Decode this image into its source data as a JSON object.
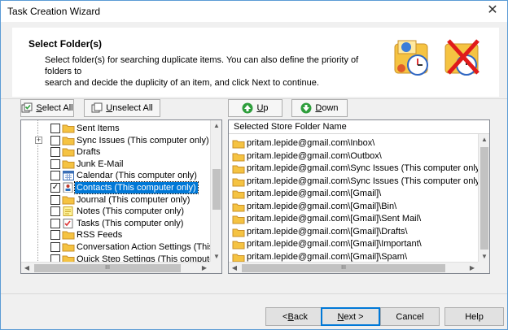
{
  "window": {
    "title": "Task Creation Wizard"
  },
  "header": {
    "title": "Select Folder(s)",
    "description_line1": "Select folder(s) for searching duplicate items. You can also define the priority of folders to",
    "description_line2": "search and decide the duplicity of an item, and click Next to continue."
  },
  "tree_toolbar": {
    "select_all": {
      "mnemonic": "S",
      "rest": "elect All"
    },
    "unselect_all": {
      "mnemonic": "U",
      "rest": "nselect All"
    }
  },
  "list_toolbar": {
    "up": {
      "mnemonic": "U",
      "rest": "p"
    },
    "down": {
      "mnemonic": "D",
      "rest": "own"
    }
  },
  "tree": {
    "items": [
      {
        "label": "Sent Items",
        "checked": false,
        "icon": "folder-icon"
      },
      {
        "label": "Sync Issues (This computer only)",
        "checked": false,
        "icon": "folder-icon",
        "expandable": true
      },
      {
        "label": "Drafts",
        "checked": false,
        "icon": "folder-icon"
      },
      {
        "label": "Junk E-Mail",
        "checked": false,
        "icon": "folder-icon"
      },
      {
        "label": "Calendar (This computer only)",
        "checked": false,
        "icon": "calendar-icon"
      },
      {
        "label": "Contacts (This computer only)",
        "checked": true,
        "icon": "contacts-icon",
        "selected": true
      },
      {
        "label": "Journal (This computer only)",
        "checked": false,
        "icon": "folder-icon"
      },
      {
        "label": "Notes (This computer only)",
        "checked": false,
        "icon": "note-icon"
      },
      {
        "label": "Tasks (This computer only)",
        "checked": false,
        "icon": "tasks-icon"
      },
      {
        "label": "RSS Feeds",
        "checked": false,
        "icon": "folder-icon"
      },
      {
        "label": "Conversation Action Settings (This cor",
        "checked": false,
        "icon": "folder-icon"
      },
      {
        "label": "Quick Step Settings (This computer or",
        "checked": false,
        "icon": "folder-icon"
      }
    ],
    "check_mark": "✓",
    "expander_symbol": "+"
  },
  "list": {
    "column_header": "Selected Store Folder Name",
    "rows": [
      "pritam.lepide@gmail.com\\Inbox\\",
      "pritam.lepide@gmail.com\\Outbox\\",
      "pritam.lepide@gmail.com\\Sync Issues (This computer only)\\",
      "pritam.lepide@gmail.com\\Sync Issues (This computer only)\\Local F",
      "pritam.lepide@gmail.com\\[Gmail]\\",
      "pritam.lepide@gmail.com\\[Gmail]\\Bin\\",
      "pritam.lepide@gmail.com\\[Gmail]\\Sent Mail\\",
      "pritam.lepide@gmail.com\\[Gmail]\\Drafts\\",
      "pritam.lepide@gmail.com\\[Gmail]\\Important\\",
      "pritam.lepide@gmail.com\\[Gmail]\\Spam\\"
    ]
  },
  "scroll": {
    "grip": "III",
    "left_arrow": "◀",
    "right_arrow": "▶",
    "up_arrow": "▲",
    "down_arrow": "▼"
  },
  "footer": {
    "back": {
      "pre": "< ",
      "mnemonic": "B",
      "rest": "ack"
    },
    "next": {
      "mnemonic": "N",
      "rest": "ext >"
    },
    "cancel": "Cancel",
    "help": "Help"
  },
  "close_symbol": "✕",
  "colors": {
    "accent": "#0078d7",
    "folder": "#f5c342",
    "up_arrow": "#2e9e3c",
    "down_arrow": "#2e9e3c"
  }
}
